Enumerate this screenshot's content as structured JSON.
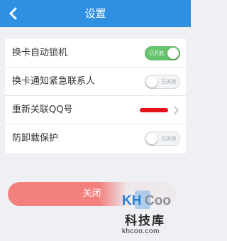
{
  "header": {
    "title": "设置",
    "back_icon": "chevron-left-icon",
    "bg_color": "#2f8fe0"
  },
  "settings": {
    "items": [
      {
        "label": "换卡自动锁机",
        "control": "toggle",
        "state": "on",
        "state_text": "已开启"
      },
      {
        "label": "换卡通知紧急联系人",
        "control": "toggle",
        "state": "off",
        "state_text": "已关闭"
      },
      {
        "label": "重新关联QQ号",
        "control": "link",
        "value_redacted": true,
        "icon": "chevron-right-icon"
      },
      {
        "label": "防卸载保护",
        "control": "toggle",
        "state": "off",
        "state_text": "已关闭"
      }
    ]
  },
  "close_button": {
    "label": "关闭"
  },
  "watermark": {
    "logo_text": "KHCoo",
    "chinese": "科技库",
    "url": "khcoo.com"
  },
  "colors": {
    "toggle_on": "#66c46e",
    "close_button": "#f3807d",
    "redaction": "#e5121b"
  }
}
